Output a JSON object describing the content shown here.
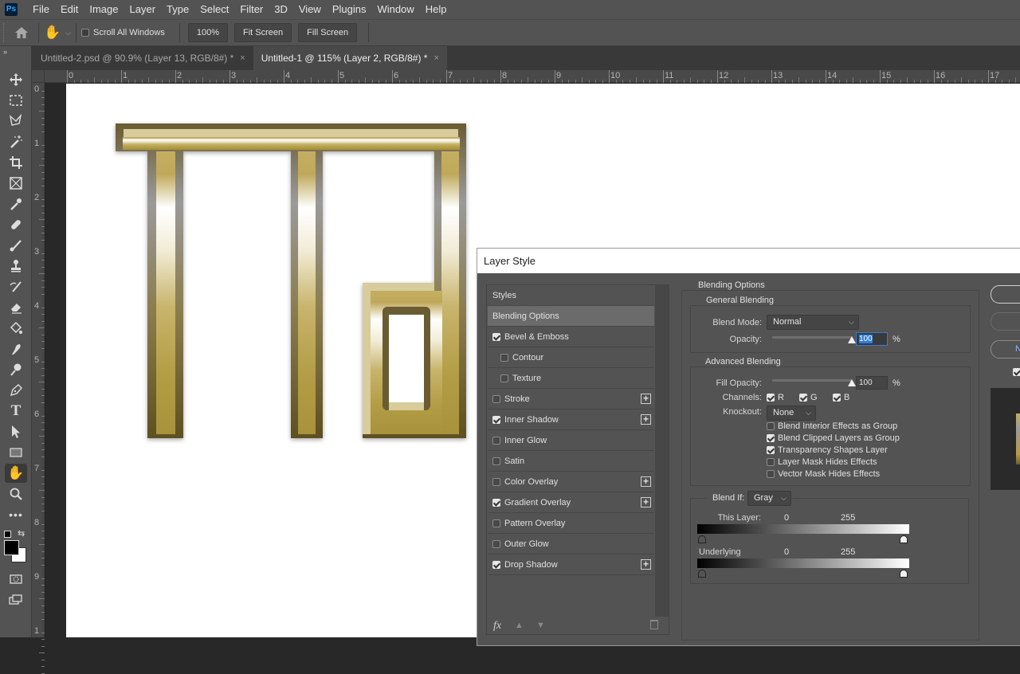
{
  "app": {
    "logo": "Ps",
    "brand_color": "#31a8ff"
  },
  "menubar": {
    "items": [
      "File",
      "Edit",
      "Image",
      "Layer",
      "Type",
      "Select",
      "Filter",
      "3D",
      "View",
      "Plugins",
      "Window",
      "Help"
    ]
  },
  "options_bar": {
    "scroll_all_windows_label": "Scroll All Windows",
    "scroll_all_windows_checked": false,
    "zoom_button": "100%",
    "fit_screen": "Fit Screen",
    "fill_screen": "Fill Screen"
  },
  "tabs": [
    {
      "label": "Untitled-2.psd @ 90.9% (Layer 13, RGB/8#) *",
      "active": false
    },
    {
      "label": "Untitled-1 @ 115% (Layer 2, RGB/8#) *",
      "active": true
    }
  ],
  "tab_close_glyph": "×",
  "rulers": {
    "horizontal": [
      "0",
      "1",
      "2",
      "3",
      "4",
      "5",
      "6",
      "7",
      "8",
      "9",
      "10",
      "11",
      "12",
      "13",
      "14",
      "15",
      "16",
      "17"
    ],
    "vertical": [
      "0",
      "1",
      "2",
      "3",
      "4",
      "5",
      "6",
      "7",
      "8",
      "9",
      "1"
    ]
  },
  "toolbar": {
    "tools": [
      "move",
      "marquee",
      "lasso",
      "magic-wand",
      "crop",
      "frame",
      "eyedropper",
      "healing-brush",
      "brush",
      "clone-stamp",
      "history-brush",
      "eraser",
      "paint-bucket",
      "smudge",
      "dodge",
      "pen",
      "type",
      "path-select",
      "rectangle",
      "hand",
      "zoom",
      "more"
    ],
    "active_tool": "hand",
    "foreground_color": "#000000",
    "background_color": "#ffffff"
  },
  "canvas": {
    "artwork": "Gold beveled monogram letters",
    "gold_light": "#e8dcae",
    "gold_mid": "#b8a24a",
    "gold_dark": "#6a5a2a"
  },
  "dialog": {
    "title": "Layer Style",
    "styles_header": "Styles",
    "style_items": [
      {
        "label": "Blending Options",
        "checkbox": false,
        "checked": false,
        "selected": true,
        "sub": false,
        "plus": false
      },
      {
        "label": "Bevel & Emboss",
        "checkbox": true,
        "checked": true,
        "selected": false,
        "sub": false,
        "plus": false
      },
      {
        "label": "Contour",
        "checkbox": true,
        "checked": false,
        "selected": false,
        "sub": true,
        "plus": false
      },
      {
        "label": "Texture",
        "checkbox": true,
        "checked": false,
        "selected": false,
        "sub": true,
        "plus": false
      },
      {
        "label": "Stroke",
        "checkbox": true,
        "checked": false,
        "selected": false,
        "sub": false,
        "plus": true
      },
      {
        "label": "Inner Shadow",
        "checkbox": true,
        "checked": true,
        "selected": false,
        "sub": false,
        "plus": true
      },
      {
        "label": "Inner Glow",
        "checkbox": true,
        "checked": false,
        "selected": false,
        "sub": false,
        "plus": false
      },
      {
        "label": "Satin",
        "checkbox": true,
        "checked": false,
        "selected": false,
        "sub": false,
        "plus": false
      },
      {
        "label": "Color Overlay",
        "checkbox": true,
        "checked": false,
        "selected": false,
        "sub": false,
        "plus": true
      },
      {
        "label": "Gradient Overlay",
        "checkbox": true,
        "checked": true,
        "selected": false,
        "sub": false,
        "plus": true
      },
      {
        "label": "Pattern Overlay",
        "checkbox": true,
        "checked": false,
        "selected": false,
        "sub": false,
        "plus": false
      },
      {
        "label": "Outer Glow",
        "checkbox": true,
        "checked": false,
        "selected": false,
        "sub": false,
        "plus": false
      },
      {
        "label": "Drop Shadow",
        "checkbox": true,
        "checked": true,
        "selected": false,
        "sub": false,
        "plus": true
      }
    ],
    "footer_icons": [
      "fx",
      "move-up",
      "move-down",
      "trash"
    ],
    "blending_options": {
      "title": "Blending Options",
      "general": {
        "title": "General Blending",
        "blend_mode_label": "Blend Mode:",
        "blend_mode_value": "Normal",
        "opacity_label": "Opacity:",
        "opacity_value": "100",
        "opacity_fraction": 1.0,
        "percent": "%"
      },
      "advanced": {
        "title": "Advanced Blending",
        "fill_opacity_label": "Fill Opacity:",
        "fill_opacity_value": "100",
        "fill_opacity_fraction": 1.0,
        "percent": "%",
        "channels_label": "Channels:",
        "channels": [
          {
            "label": "R",
            "checked": true
          },
          {
            "label": "G",
            "checked": true
          },
          {
            "label": "B",
            "checked": true
          }
        ],
        "knockout_label": "Knockout:",
        "knockout_value": "None",
        "options": [
          {
            "label": "Blend Interior Effects as Group",
            "checked": false
          },
          {
            "label": "Blend Clipped Layers as Group",
            "checked": true
          },
          {
            "label": "Transparency Shapes Layer",
            "checked": true
          },
          {
            "label": "Layer Mask Hides Effects",
            "checked": false
          },
          {
            "label": "Vector Mask Hides Effects",
            "checked": false
          }
        ]
      },
      "blend_if": {
        "label": "Blend If:",
        "value": "Gray",
        "this_layer_label": "This Layer:",
        "this_layer_low": "0",
        "this_layer_high": "255",
        "underlying_label": "Underlying Layer:",
        "underlying_low": "0",
        "underlying_high": "255"
      }
    },
    "right_buttons": [
      "",
      "",
      "N"
    ],
    "preview_checked": true
  }
}
